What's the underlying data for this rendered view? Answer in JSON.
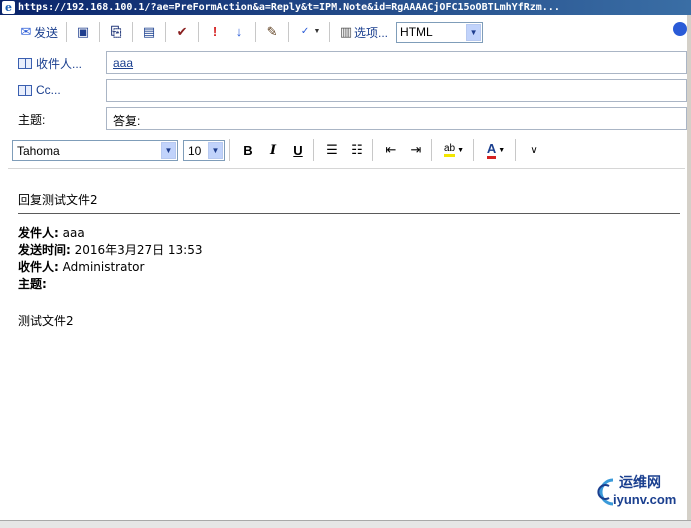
{
  "window": {
    "url": "https://192.168.100.1/?ae=PreFormAction&a=Reply&t=IPM.Note&id=RgAAAACjOFC15oOBTLmhYfRzm..."
  },
  "toolbar": {
    "send_label": "发送",
    "options_label": "选项...",
    "format_select": "HTML"
  },
  "headers": {
    "to_label": "收件人...",
    "to_value": "aaa",
    "cc_label": "Cc...",
    "cc_value": "",
    "subject_label": "主题:",
    "subject_value": "答复:"
  },
  "formatting": {
    "font": "Tahoma",
    "size": "10",
    "bold": "B",
    "italic": "I",
    "underline": "U",
    "font_color_label": "A",
    "highlight_label": "ab"
  },
  "message": {
    "reply_text": "回复测试文件2",
    "from_label": "发件人:",
    "from_value": "aaa",
    "sent_label": "发送时间:",
    "sent_value": "2016年3月27日  13:53",
    "to_label": "收件人:",
    "to_value": "Administrator",
    "subject_label": "主题:",
    "subject_value": "",
    "body": "测试文件2"
  },
  "watermark": {
    "name": "运维网",
    "url": "iyunv.com"
  },
  "icons": {
    "save": "floppy-disk-icon",
    "attach": "paperclip-icon",
    "address_book": "address-book-icon",
    "check_names": "check-names-icon",
    "importance_high": "exclamation-icon",
    "importance_low": "down-arrow-icon",
    "signature": "signature-icon",
    "spelling": "spell-check-icon",
    "help": "help-icon"
  },
  "colors": {
    "title_bar": "#0a246a",
    "link": "#1a3f8f",
    "importance_red": "#d42020",
    "font_color_red": "#d42020",
    "highlight_yellow": "#f2e600"
  }
}
